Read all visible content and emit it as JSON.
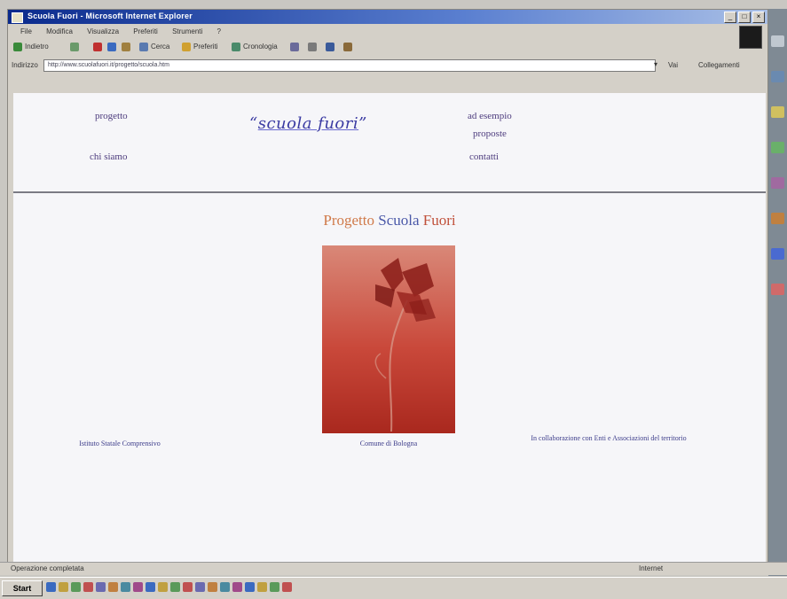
{
  "window": {
    "title": "Scuola Fuori - Microsoft Internet Explorer",
    "controls": [
      "_",
      "□",
      "×"
    ]
  },
  "menu": [
    "File",
    "Modifica",
    "Visualizza",
    "Preferiti",
    "Strumenti",
    "?"
  ],
  "toolbar": {
    "back": "Indietro",
    "search": "Cerca",
    "favorites": "Preferiti",
    "history": "Cronologia"
  },
  "address": {
    "label": "Indirizzo",
    "value": "http://www.scuolafuori.it/progetto/scuola.htm",
    "go": "Vai",
    "links": "Collegamenti"
  },
  "header": {
    "left_links": [
      "progetto",
      "chi siamo"
    ],
    "logo_open_quote": "“",
    "logo": "scuola fuori",
    "logo_close_quote": "”",
    "right_links": [
      "ad esempio",
      "proposte",
      "contatti"
    ]
  },
  "page_title": {
    "part1": "Progetto",
    "part2": "Scuola",
    "part3": "Fuori"
  },
  "captions": {
    "left": "Istituto Statale Comprensivo",
    "center": "Comune di Bologna",
    "right": "In collaborazione con Enti e Associazioni del territorio"
  },
  "status": {
    "text": "Operazione completata",
    "zone": "Internet"
  },
  "taskbar": {
    "start": "Start"
  },
  "colors": {
    "title_orange": "#d07a4a",
    "title_blue": "#4a58a8",
    "title_red": "#c0503a",
    "link_purple": "#4c3b7d",
    "poster_red": "#c9483a"
  }
}
